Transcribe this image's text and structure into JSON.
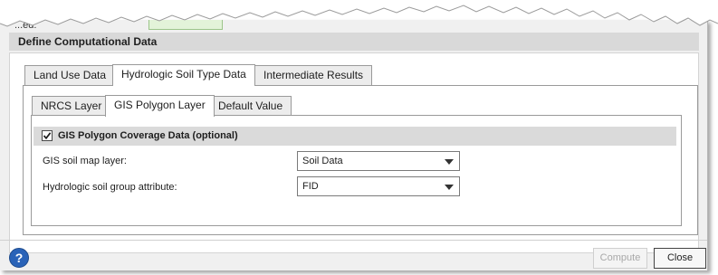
{
  "partial": {
    "text": "...ed:"
  },
  "section": {
    "title": "Define Computational Data"
  },
  "main_tabs": [
    {
      "label": "Land Use Data",
      "active": false
    },
    {
      "label": "Hydrologic Soil Type Data",
      "active": true
    },
    {
      "label": "Intermediate Results",
      "active": false
    }
  ],
  "sub_tabs": [
    {
      "label": "NRCS Layer",
      "active": false
    },
    {
      "label": "GIS Polygon Layer",
      "active": true
    },
    {
      "label": "Default Value",
      "active": false
    }
  ],
  "group": {
    "label": "GIS Polygon Coverage Data (optional)",
    "checked": true
  },
  "fields": [
    {
      "label": "GIS soil map layer:",
      "value": "Soil Data"
    },
    {
      "label": "Hydrologic soil group attribute:",
      "value": "FID"
    }
  ],
  "footer": {
    "help": "?",
    "compute": "Compute",
    "close": "Close"
  }
}
